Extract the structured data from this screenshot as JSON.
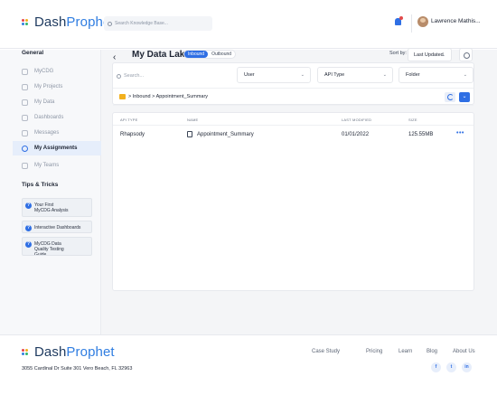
{
  "brand": {
    "name_dark": "Dash",
    "name_accent": "Prophet",
    "dot_colors": [
      "#e8434a",
      "#f2b01e",
      "#2f7de1",
      "#31b46b"
    ]
  },
  "header": {
    "search_placeholder": "Search Knowledge Base...",
    "user_name": "Lawrence Mathis..."
  },
  "sidebar": {
    "general_heading": "General",
    "items": [
      {
        "label": "MyCDG",
        "icon": "home-icon"
      },
      {
        "label": "My Projects",
        "icon": "file-icon"
      },
      {
        "label": "My Data",
        "icon": "clipboard-icon"
      },
      {
        "label": "Dashboards",
        "icon": "dashboard-icon"
      },
      {
        "label": "Messages",
        "icon": "chat-icon"
      },
      {
        "label": "My Assignments",
        "icon": "assignment-icon",
        "active": true
      },
      {
        "label": "My Teams",
        "icon": "team-icon"
      }
    ],
    "tips_heading": "Tips & Tricks",
    "tips": [
      "Your First MyCDG Analysis",
      "Interactive Dashboards",
      "MyCDG Data Quality Testing Guide"
    ]
  },
  "main": {
    "title": "My Data Lake",
    "tabs": [
      "Inbound",
      "Outbound"
    ],
    "active_tab": "Inbound",
    "sort_label": "Sort by:",
    "sort_value": "Last Updated",
    "search_placeholder": "Search...",
    "filters": [
      "User",
      "API Type",
      "Folder"
    ],
    "breadcrumb": "> Inbound > Appointment_Summary",
    "table": {
      "columns": [
        "API TYPE",
        "NAME",
        "LAST MODIFIED",
        "SIZE"
      ],
      "rows": [
        {
          "api_type": "Rhapsody",
          "name": "Appointment_Summary",
          "last_modified": "01/01/2022",
          "size": "125.55MB",
          "actions": "•••"
        }
      ]
    }
  },
  "footer": {
    "address": "3055 Cardinal Dr Suite 301 Vero Beach, FL 32963",
    "links": [
      "Case Study",
      "Pricing",
      "Learn",
      "Blog",
      "About Us"
    ],
    "social": [
      "f",
      "t",
      "in"
    ]
  },
  "colors": {
    "accent": "#2f6fe4",
    "folder": "#f2b01e",
    "sidebar_bg": "#f7f8fa",
    "main_bg": "#f4f5f7"
  }
}
